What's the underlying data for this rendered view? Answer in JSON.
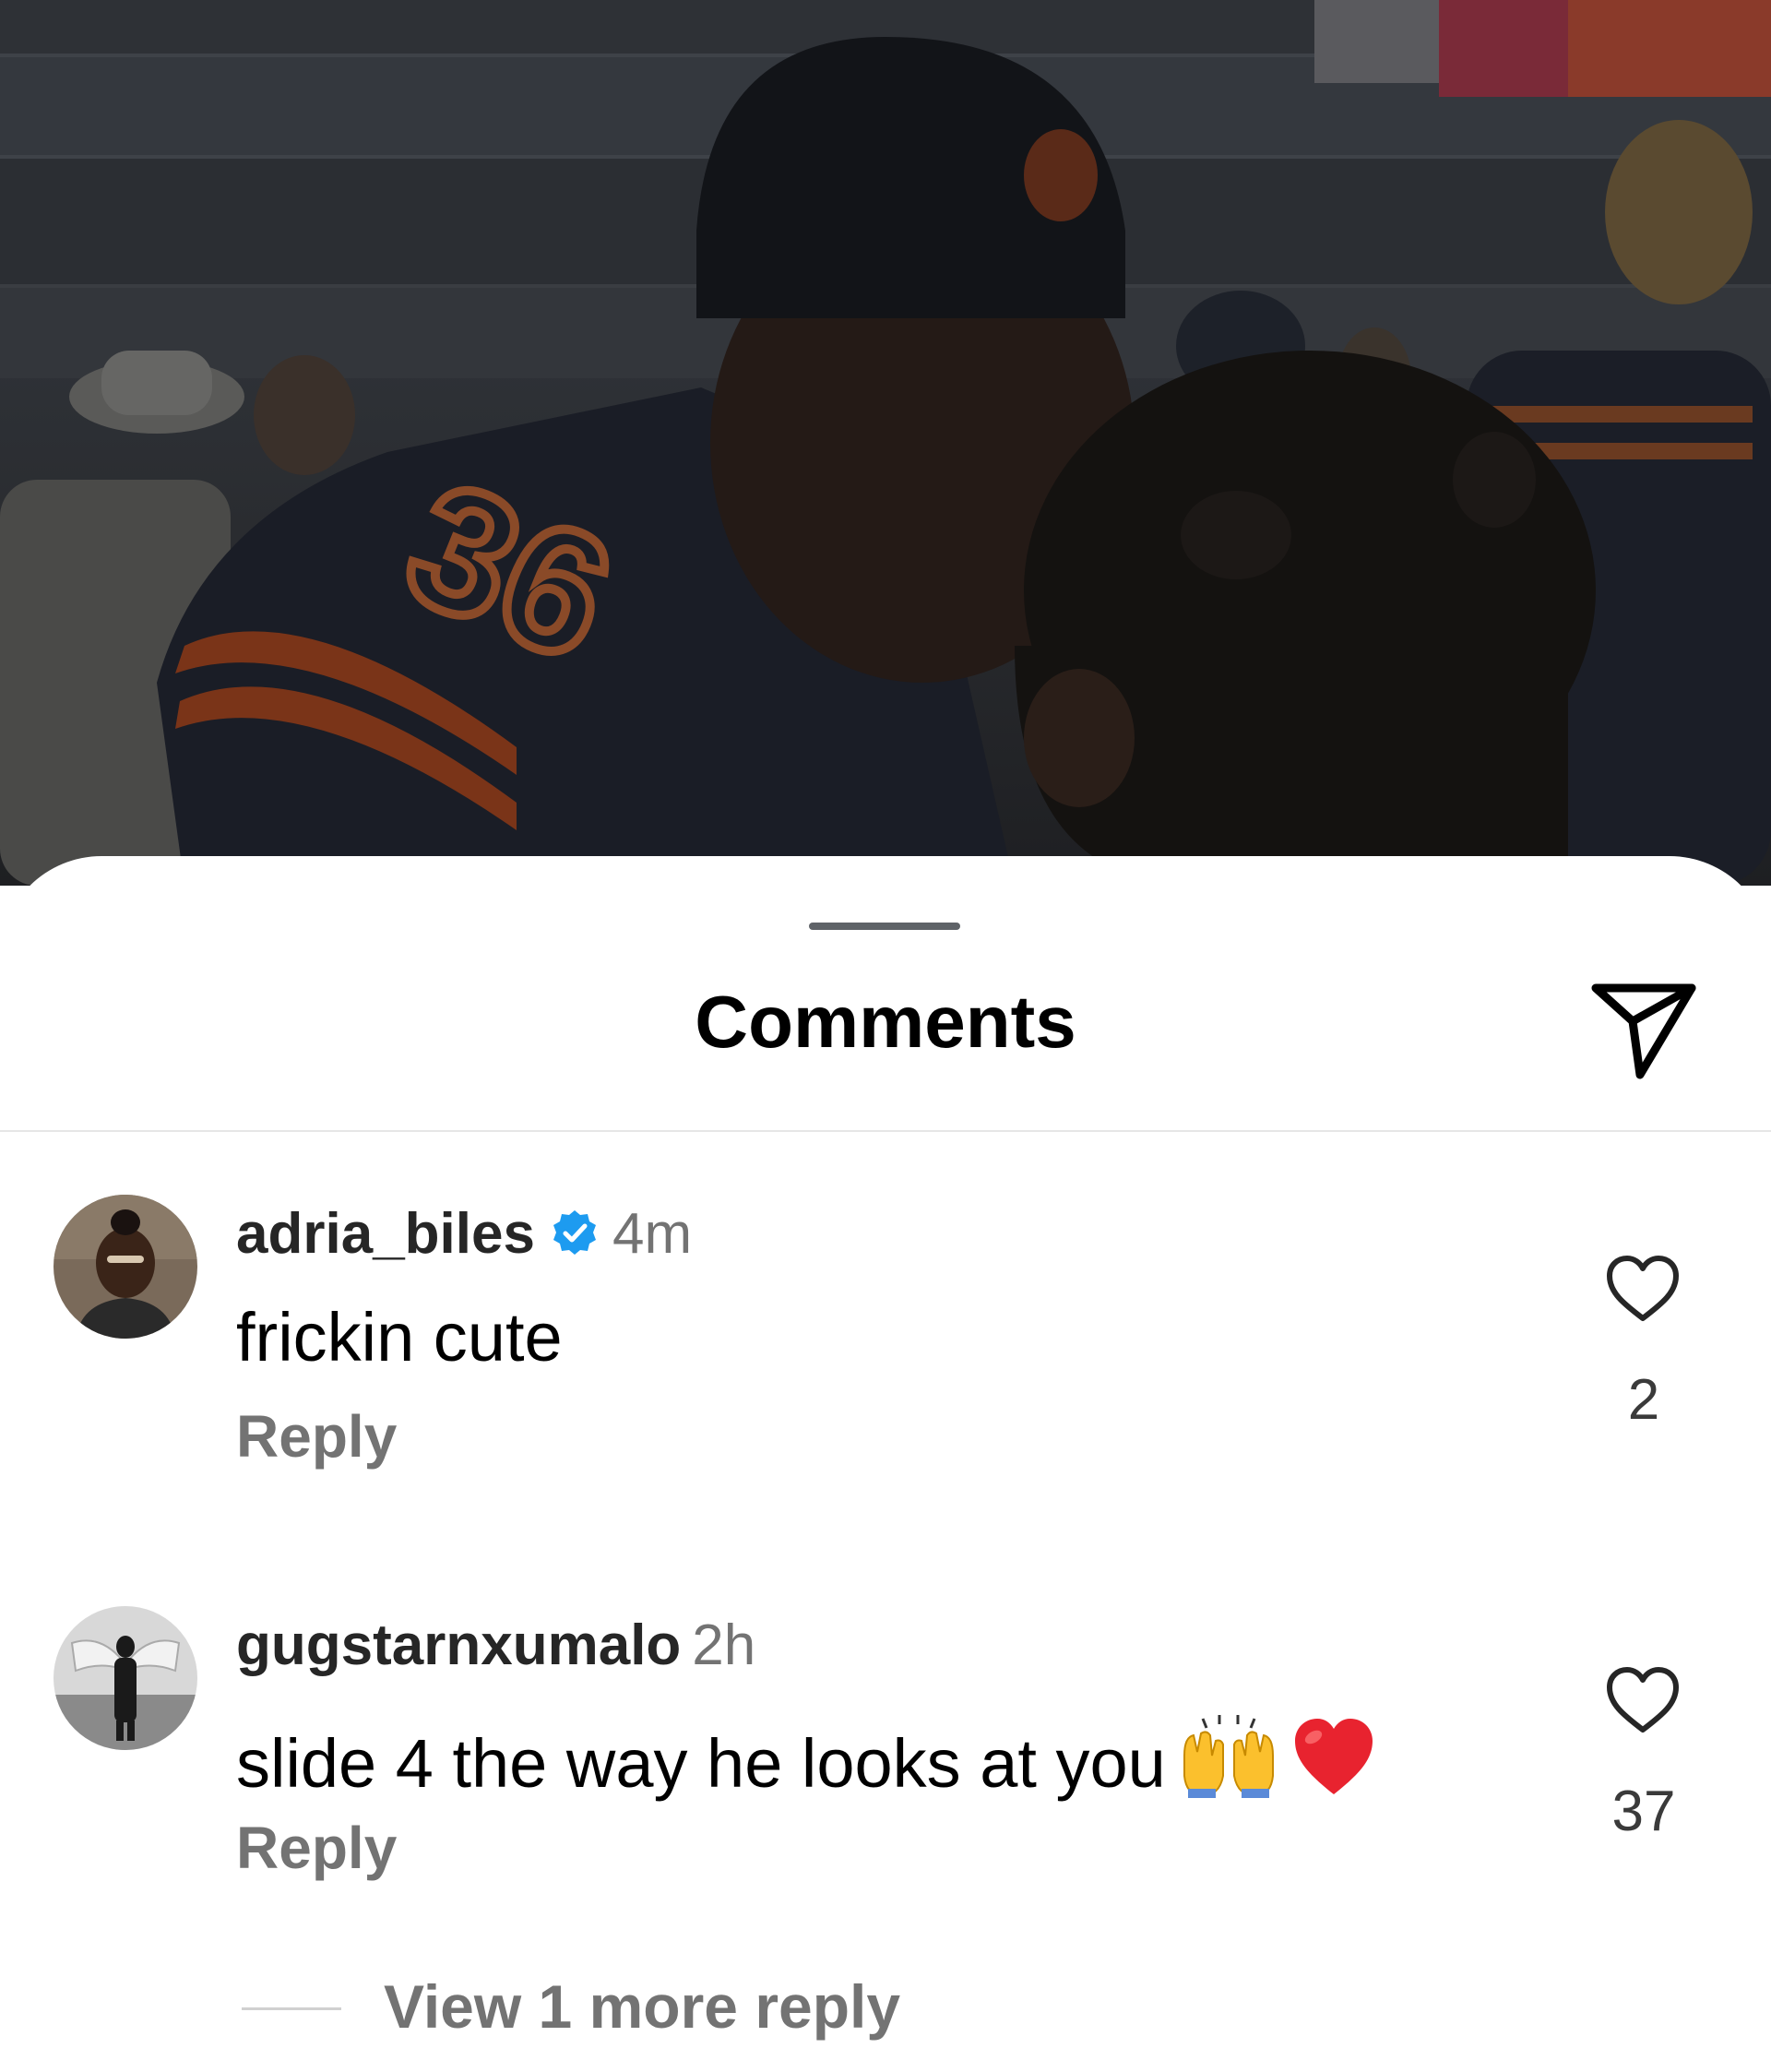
{
  "sheet": {
    "title": "Comments",
    "share_icon": "send-paper-plane-icon"
  },
  "comments": [
    {
      "username": "adria_biles",
      "verified": true,
      "time": "4m",
      "text": "frickin cute",
      "emojis": [],
      "reply_label": "Reply",
      "like_count": "2"
    },
    {
      "username": "gugstarnxumalo",
      "verified": false,
      "time": "2h",
      "text": "slide 4 the way he looks at you",
      "emojis": [
        "raising-hands-emoji",
        "red-heart-emoji"
      ],
      "reply_label": "Reply",
      "like_count": "37"
    }
  ],
  "view_more_replies": "View 1 more reply",
  "colors": {
    "verified_badge": "#1d9bf0",
    "secondary_text": "#737373",
    "heart_red": "#e8232f"
  }
}
